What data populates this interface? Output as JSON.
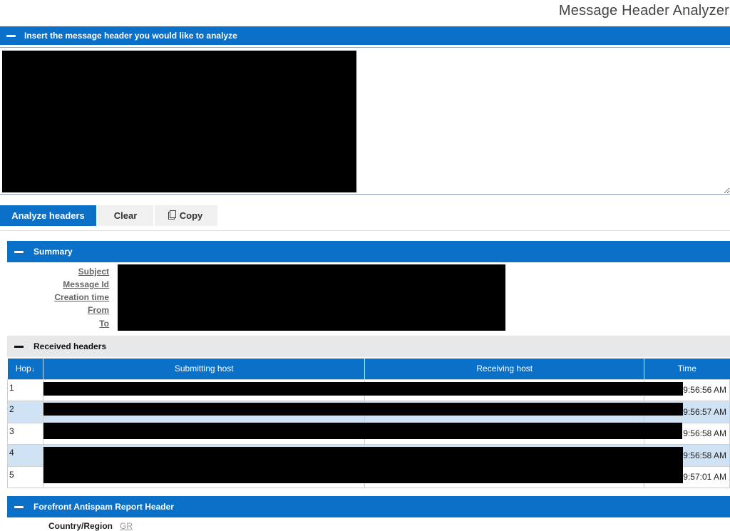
{
  "app": {
    "title": "Message Header Analyzer"
  },
  "insert_section": {
    "label": "Insert the message header you would like to analyze"
  },
  "textarea": {
    "value": "",
    "placeholder": ""
  },
  "buttons": {
    "analyze": "Analyze headers",
    "clear": "Clear",
    "copy": "Copy"
  },
  "summary": {
    "label": "Summary",
    "fields": [
      "Subject",
      "Message Id",
      "Creation time",
      "From",
      "To"
    ]
  },
  "received": {
    "label": "Received headers",
    "columns": {
      "hop": "Hop",
      "sort_indicator": "↓",
      "submitting": "Submitting host",
      "receiving": "Receiving host",
      "time": "Time"
    },
    "rows": [
      {
        "hop": "1",
        "time": "9:56:56 AM"
      },
      {
        "hop": "2",
        "time": "9:56:57 AM"
      },
      {
        "hop": "3",
        "time": "9:56:58 AM"
      },
      {
        "hop": "4",
        "time": "9:56:58 AM"
      },
      {
        "hop": "5",
        "time": "9:57:01 AM"
      }
    ]
  },
  "forefront": {
    "label": "Forefront Antispam Report Header",
    "country_label": "Country/Region",
    "country_value": "GR"
  },
  "colors": {
    "accent": "#0a70c8",
    "row_alt": "#cfe3f5",
    "section_grey": "#e7e8ea"
  }
}
